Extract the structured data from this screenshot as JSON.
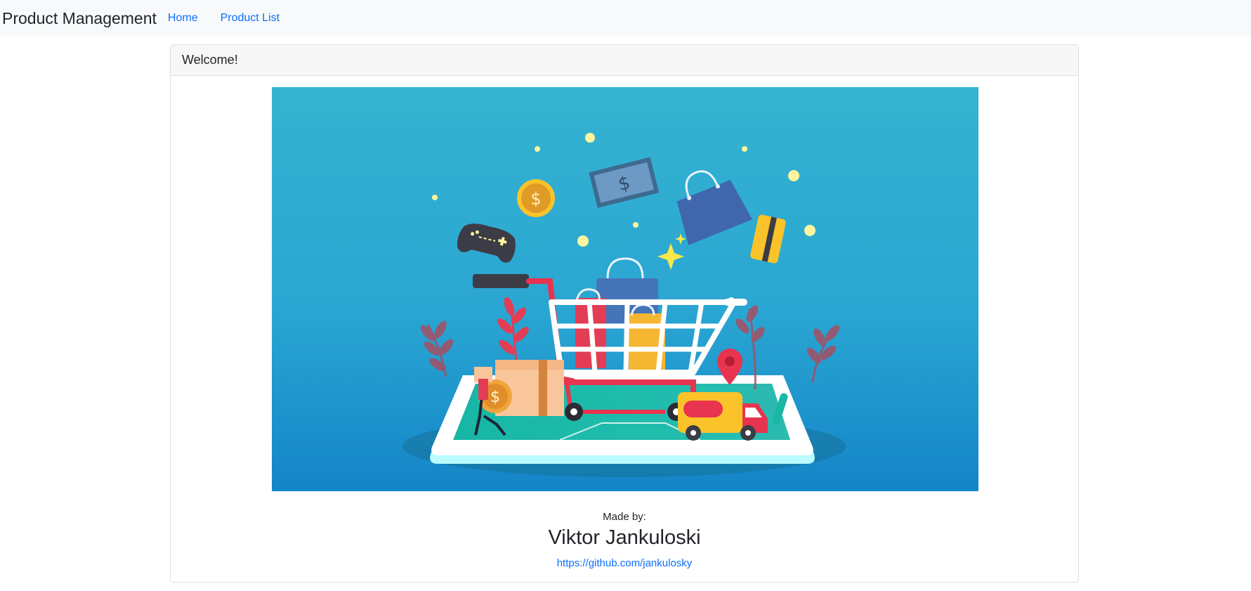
{
  "navbar": {
    "brand": "Product Management",
    "links": [
      {
        "label": "Home"
      },
      {
        "label": "Product List"
      }
    ]
  },
  "card": {
    "header": "Welcome!",
    "made_by_label": "Made by:",
    "author": "Viktor Jankuloski",
    "link": "https://github.com/jankulosky"
  },
  "hero": {
    "subject": "shopping-cart-illustration",
    "currency_glyph": "$"
  },
  "colors": {
    "link": "#0d6efd",
    "navbar_bg": "#f8f9fa",
    "hero_top": "#35b3d0",
    "hero_bottom": "#1485c8"
  }
}
